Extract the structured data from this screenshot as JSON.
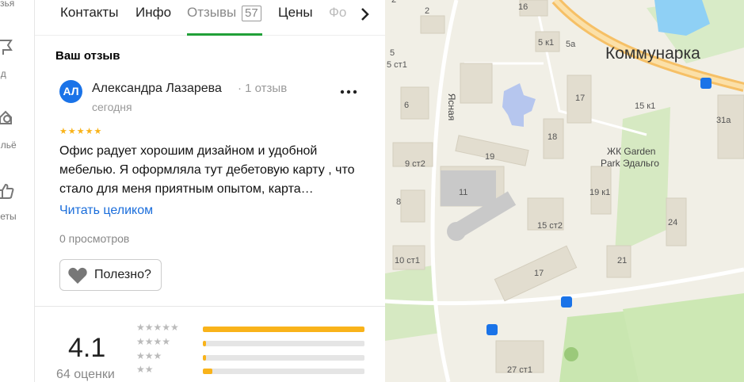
{
  "rail": {
    "items": [
      {
        "label": "узья",
        "icon": "friends-icon"
      },
      {
        "label": "ид",
        "icon": "guide-icon"
      },
      {
        "label": "ильё",
        "icon": "housing-icon"
      },
      {
        "label": "веты",
        "icon": "tips-icon"
      }
    ]
  },
  "tabs": {
    "items": [
      {
        "label": "Контакты"
      },
      {
        "label": "Инфо"
      },
      {
        "label": "Отзывы",
        "count": "57",
        "active": true
      },
      {
        "label": "Цены"
      },
      {
        "label": "Фо"
      }
    ]
  },
  "review": {
    "heading": "Ваш отзыв",
    "avatar_initials": "АЛ",
    "author": "Александра Лазарева",
    "author_reviews": "· 1 отзыв",
    "date": "сегодня",
    "stars": "★★★★★",
    "rating": 5,
    "text": "Офис радует хорошим дизайном и удобной мебелью. Я оформляла тут дебетовую карту , что стало для меня приятным опытом, карта…",
    "read_more": "Читать целиком",
    "views": "0 просмотров",
    "useful": "Полезно?"
  },
  "rating_summary": {
    "value": "4.1",
    "count_label": "64 оценки",
    "distribution": [
      {
        "stars": "★★★★★",
        "fraction": 1.0
      },
      {
        "stars": "★★★★",
        "fraction": 0.02
      },
      {
        "stars": "★★★",
        "fraction": 0.02
      },
      {
        "stars": "★★",
        "fraction": 0.06
      }
    ]
  },
  "map": {
    "labels": [
      {
        "text": "Коммунарка",
        "kind": "district"
      },
      {
        "text": "ЖК Garden",
        "kind": "complex"
      },
      {
        "text": "Park Эдальго",
        "kind": "complex"
      },
      {
        "text": "Ясная",
        "kind": "street"
      },
      {
        "text": "2"
      },
      {
        "text": "16"
      },
      {
        "text": "5 к1"
      },
      {
        "text": "5а"
      },
      {
        "text": "5 ст1"
      },
      {
        "text": "6"
      },
      {
        "text": "17"
      },
      {
        "text": "15 к1"
      },
      {
        "text": "31а"
      },
      {
        "text": "18"
      },
      {
        "text": "19"
      },
      {
        "text": "9 ст2"
      },
      {
        "text": "11"
      },
      {
        "text": "19 к1"
      },
      {
        "text": "8"
      },
      {
        "text": "15 ст2"
      },
      {
        "text": "24"
      },
      {
        "text": "10 ст1"
      },
      {
        "text": "21"
      },
      {
        "text": "17"
      },
      {
        "text": "27 ст1"
      },
      {
        "text": "5"
      },
      {
        "text": "2"
      }
    ]
  },
  "colors": {
    "accent_green": "#21a038",
    "star_yellow": "#f9b31a",
    "link_blue": "#1a6ddb",
    "avatar_blue": "#1a73e8",
    "road_orange": "#f6c066",
    "water": "#8fd0f5",
    "park_green": "#c9e6b0"
  }
}
